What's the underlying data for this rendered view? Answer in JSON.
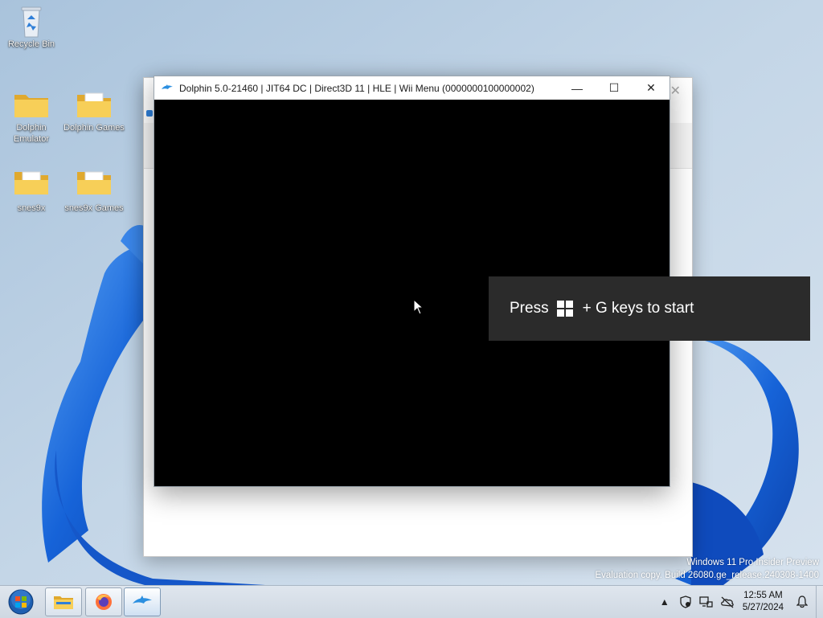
{
  "desktop": {
    "icons": [
      {
        "label": "Recycle Bin",
        "icon": "recycle-bin-icon"
      },
      {
        "label": "Dolphin Emulator",
        "icon": "folder-icon"
      },
      {
        "label": "Dolphin Games",
        "icon": "folder-icon"
      },
      {
        "label": "snes9x",
        "icon": "folder-icon"
      },
      {
        "label": "snes9x Games",
        "icon": "folder-icon"
      }
    ]
  },
  "dolphin_window": {
    "title": "Dolphin 5.0-21460 | JIT64 DC | Direct3D 11 | HLE | Wii Menu (0000000100000002)",
    "minimize_glyph": "—",
    "maximize_glyph": "☐",
    "close_glyph": "✕"
  },
  "gamebar_prompt": {
    "before": "Press",
    "after": "+ G keys to start"
  },
  "watermark": {
    "line1": "Windows 11 Pro Insider Preview",
    "line2": "Evaluation copy. Build 26080.ge_release.240308-1400"
  },
  "taskbar": {
    "apps": [
      {
        "name": "File Explorer",
        "icon": "file-explorer-icon"
      },
      {
        "name": "Firefox",
        "icon": "firefox-icon"
      },
      {
        "name": "Dolphin",
        "icon": "dolphin-icon"
      }
    ],
    "clock": {
      "time": "12:55 AM",
      "date": "5/27/2024"
    }
  },
  "colors": {
    "wallpaper_bg": "#b9cfe3",
    "bloom_blue": "#1663d8",
    "toast_bg": "#2b2b2b",
    "folder_yellow": "#f3c64a"
  }
}
